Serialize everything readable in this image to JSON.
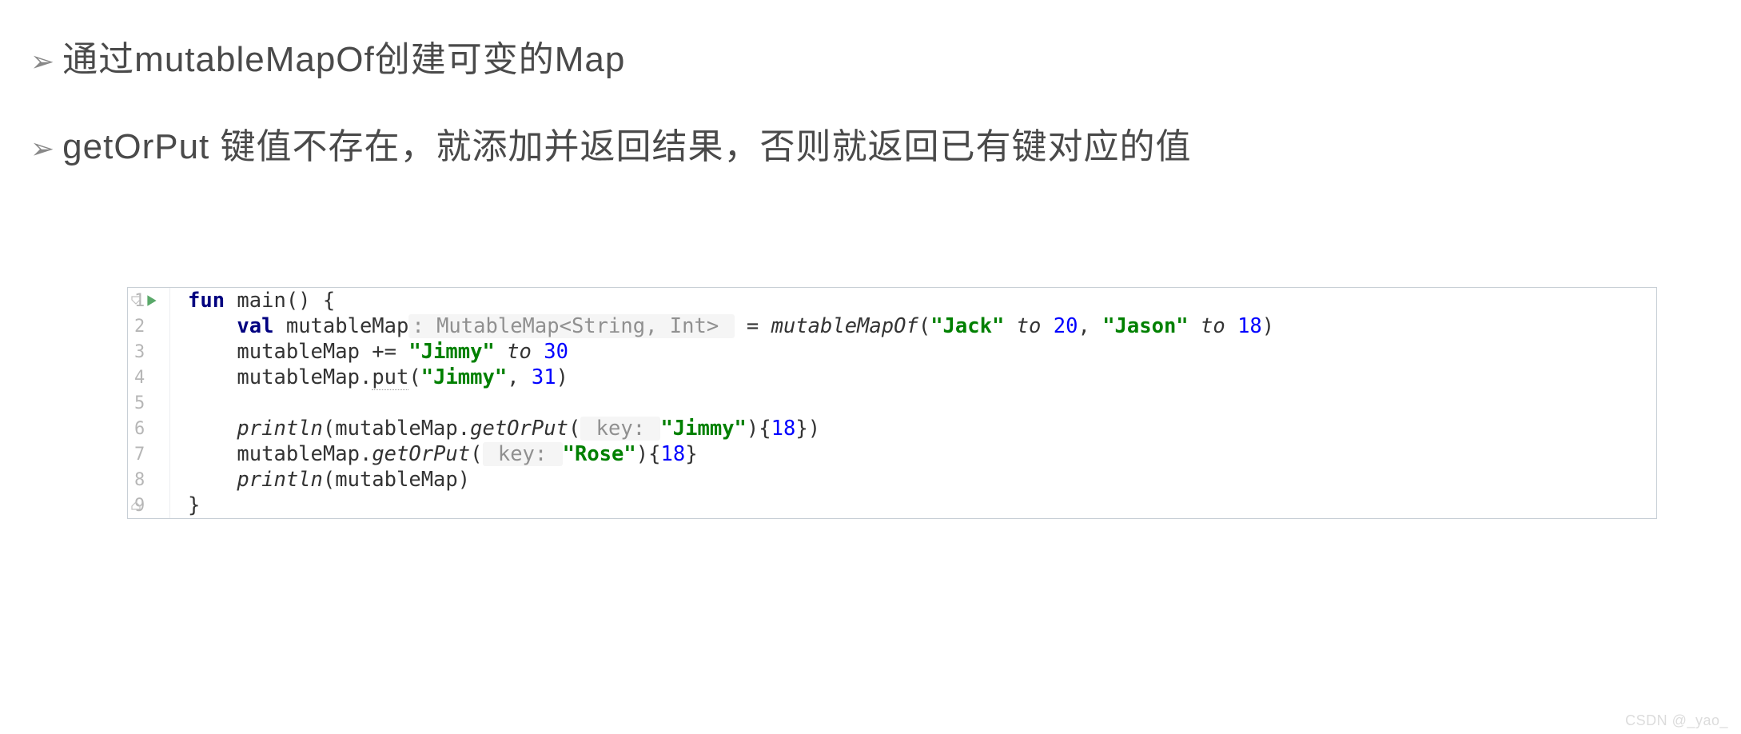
{
  "bullets": {
    "b1": "通过mutableMapOf创建可变的Map",
    "b2": "getOrPut 键值不存在，就添加并返回结果，否则就返回已有键对应的值"
  },
  "ln": {
    "l1": "1",
    "l2": "2",
    "l3": "3",
    "l4": "4",
    "l5": "5",
    "l6": "6",
    "l7": "7",
    "l8": "8",
    "l9": "9"
  },
  "c": {
    "kw_fun": "fun",
    "main_sig": " main() {",
    "kw_val": "val",
    "mm_decl1": " mutableMap",
    "hint_type": ": MutableMap<String, Int> ",
    "eq": " = ",
    "fn_mmo": "mutableMapOf",
    "paren_open": "(",
    "s_jack": "\"Jack\"",
    "to1": " to ",
    "n20": "20",
    "comma_sp": ", ",
    "s_jason": "\"Jason\"",
    "to2": " to ",
    "n18a": "18",
    "paren_close": ")",
    "l3_head": "mutableMap += ",
    "s_jimmy": "\"Jimmy\"",
    "to3": " to ",
    "n30": "30",
    "l4_head": "mutableMap.",
    "put": "put",
    "l4_open": "(",
    "l4_comma": ", ",
    "n31": "31",
    "l4_close": ")",
    "println": "println",
    "l6_open": "(mutableMap.",
    "getOrPut": "getOrPut",
    "inner_open": "(",
    "hint_key": " key: ",
    "l6_close1": ")",
    "brace_open": "{",
    "n18b": "18",
    "brace_close": "}",
    "outer_close": ")",
    "l7_head": "mutableMap.",
    "s_rose": "\"Rose\"",
    "l8_arg": "(mutableMap)",
    "rbrace": "}",
    "indent1": "    ",
    "indent_empty": ""
  },
  "watermark": "CSDN @_yao_"
}
